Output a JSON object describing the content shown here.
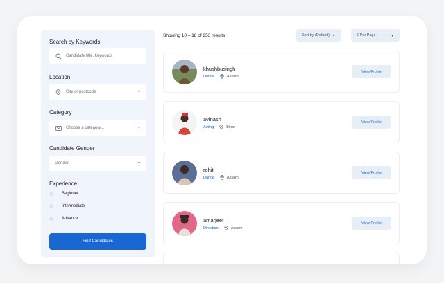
{
  "sidebar": {
    "keywords": {
      "title": "Search by Keywords",
      "placeholder": "Candidate title, keywords"
    },
    "location": {
      "title": "Location",
      "placeholder": "City or postcode"
    },
    "category": {
      "title": "Category",
      "placeholder": "Choose a category..."
    },
    "gender": {
      "title": "Candidate Gender",
      "value": "Gender"
    },
    "experience": {
      "title": "Experience",
      "options": [
        "Beginner",
        "Intermediate",
        "Advance"
      ]
    },
    "find_button": "Find Candidates"
  },
  "results": {
    "summary": "Showing 10 – 18 of 253 results",
    "sort_label": "Sort by (Default)",
    "per_page_label": "6 Per Page"
  },
  "candidates": [
    {
      "name": "khushbusingh",
      "category": "Dance",
      "location": "Assam",
      "button": "View Profile"
    },
    {
      "name": "avinash",
      "category": "Acting",
      "location": "Bihar",
      "button": "View Profile"
    },
    {
      "name": "rohit",
      "category": "Dance",
      "location": "Assam",
      "button": "View Profile"
    },
    {
      "name": "amarjeet",
      "category": "Direction",
      "location": "Assam",
      "button": "View Profile"
    }
  ],
  "colors": {
    "accent": "#1967d2",
    "panel": "#f0f4fb",
    "soft_button": "#e8eef6"
  },
  "icons": {
    "keywords": "search-icon",
    "location": "map-pin-icon",
    "category": "envelope-icon"
  }
}
